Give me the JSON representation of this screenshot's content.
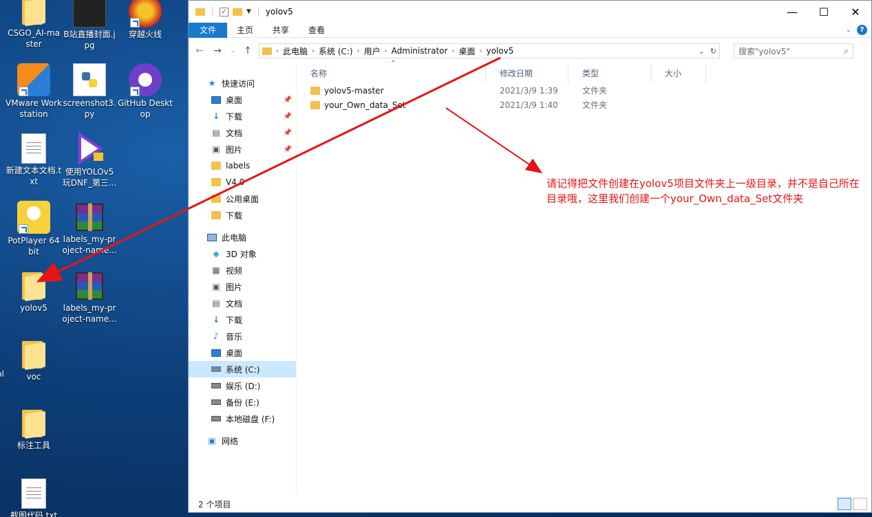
{
  "desktop": {
    "icons": [
      {
        "label": "CSGO_AI-master",
        "icon": "folder-icon"
      },
      {
        "label": "B站直播封面.jpg",
        "icon": "image-icon"
      },
      {
        "label": "穿越火线",
        "icon": "crossfire-icon"
      },
      {
        "label": "VMware Workstation",
        "icon": "vmware-icon"
      },
      {
        "label": "screenshot3.py",
        "icon": "python-icon"
      },
      {
        "label": "GitHub Desktop",
        "icon": "github-icon"
      },
      {
        "label": "新建文本文档.txt",
        "icon": "text-file-icon"
      },
      {
        "label": "使用YOLOv5玩DNF_第三...",
        "icon": "video-icon"
      },
      {
        "label": "PotPlayer 64 bit",
        "icon": "potplayer-icon"
      },
      {
        "label": "labels_my-project-name...",
        "icon": "rar-icon"
      },
      {
        "label": "yolov5",
        "icon": "folder-icon"
      },
      {
        "label": "labels_my-project-name...",
        "icon": "rar-icon"
      },
      {
        "label": "voc",
        "icon": "folder-icon"
      },
      {
        "label": "标注工具",
        "icon": "folder-icon"
      },
      {
        "label": "截图代码.txt",
        "icon": "text-file-icon"
      },
      {
        "label": "ol",
        "icon": "partial-icon"
      }
    ]
  },
  "window": {
    "title": "yolov5",
    "ribbon_tabs": [
      "文件",
      "主页",
      "共享",
      "查看"
    ],
    "address_path": [
      "此电脑",
      "系统 (C:)",
      "用户",
      "Administrator",
      "桌面",
      "yolov5"
    ],
    "search_placeholder": "搜索\"yolov5\"",
    "nav_pane": {
      "quick_access": "快速访问",
      "quick_items": [
        "桌面",
        "下载",
        "文档",
        "图片",
        "labels",
        "V4.0",
        "公用桌面",
        "下载"
      ],
      "this_pc": "此电脑",
      "pc_items": [
        "3D 对象",
        "视频",
        "图片",
        "文档",
        "下载",
        "音乐",
        "桌面",
        "系统 (C:)",
        "娱乐 (D:)",
        "备份 (E:)",
        "本地磁盘 (F:)"
      ],
      "network": "网络"
    },
    "columns": [
      "名称",
      "修改日期",
      "类型",
      "大小"
    ],
    "files": [
      {
        "name": "yolov5-master",
        "date": "2021/3/9 1:39",
        "type": "文件夹",
        "size": ""
      },
      {
        "name": "your_Own_data_Set",
        "date": "2021/3/9 1:40",
        "type": "文件夹",
        "size": ""
      }
    ],
    "status": "2 个项目"
  },
  "annotation": {
    "text": "请记得把文件创建在yolov5项目文件夹上一级目录，并不是自己所在目录哦，这里我们创建一个your_Own_data_Set文件夹",
    "color": "#e81414"
  }
}
